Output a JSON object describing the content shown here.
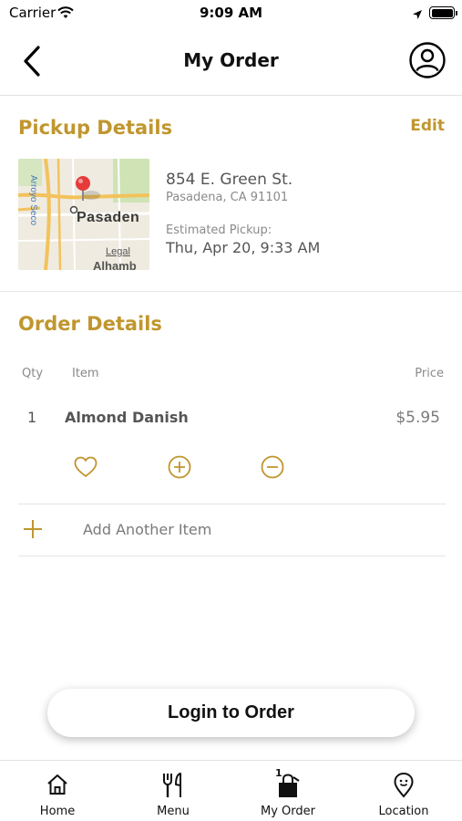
{
  "status_bar": {
    "carrier": "Carrier",
    "time": "9:09 AM"
  },
  "nav": {
    "title": "My Order",
    "back_icon": "chevron-left-icon",
    "profile_icon": "user-circle-icon"
  },
  "pickup": {
    "title": "Pickup Details",
    "edit_label": "Edit",
    "map": {
      "city_label": "Pasaden",
      "street_label": "Arroyo Seco",
      "legal_label": "Legal",
      "bottom_label": "Alhamb"
    },
    "address_line1": "854 E. Green St.",
    "address_line2": "Pasadena, CA 91101",
    "estimated_label": "Estimated Pickup:",
    "estimated_value": "Thu, Apr 20, 9:33 AM"
  },
  "order": {
    "title": "Order Details",
    "columns": {
      "qty": "Qty",
      "item": "Item",
      "price": "Price"
    },
    "items": [
      {
        "qty": "1",
        "name": "Almond Danish",
        "price": "$5.95"
      }
    ],
    "item_actions": [
      "heart-icon",
      "plus-circle-icon",
      "minus-circle-icon"
    ],
    "add_another_label": "Add Another Item"
  },
  "login_button": "Login to Order",
  "tabs": [
    {
      "label": "Home",
      "icon": "home-icon"
    },
    {
      "label": "Menu",
      "icon": "utensils-icon"
    },
    {
      "label": "My Order",
      "icon": "bag-icon",
      "badge": "1"
    },
    {
      "label": "Location",
      "icon": "location-pin-icon"
    }
  ],
  "colors": {
    "accent": "#c0962e",
    "text_dark": "#111111",
    "text_muted": "#8a8a8a"
  }
}
